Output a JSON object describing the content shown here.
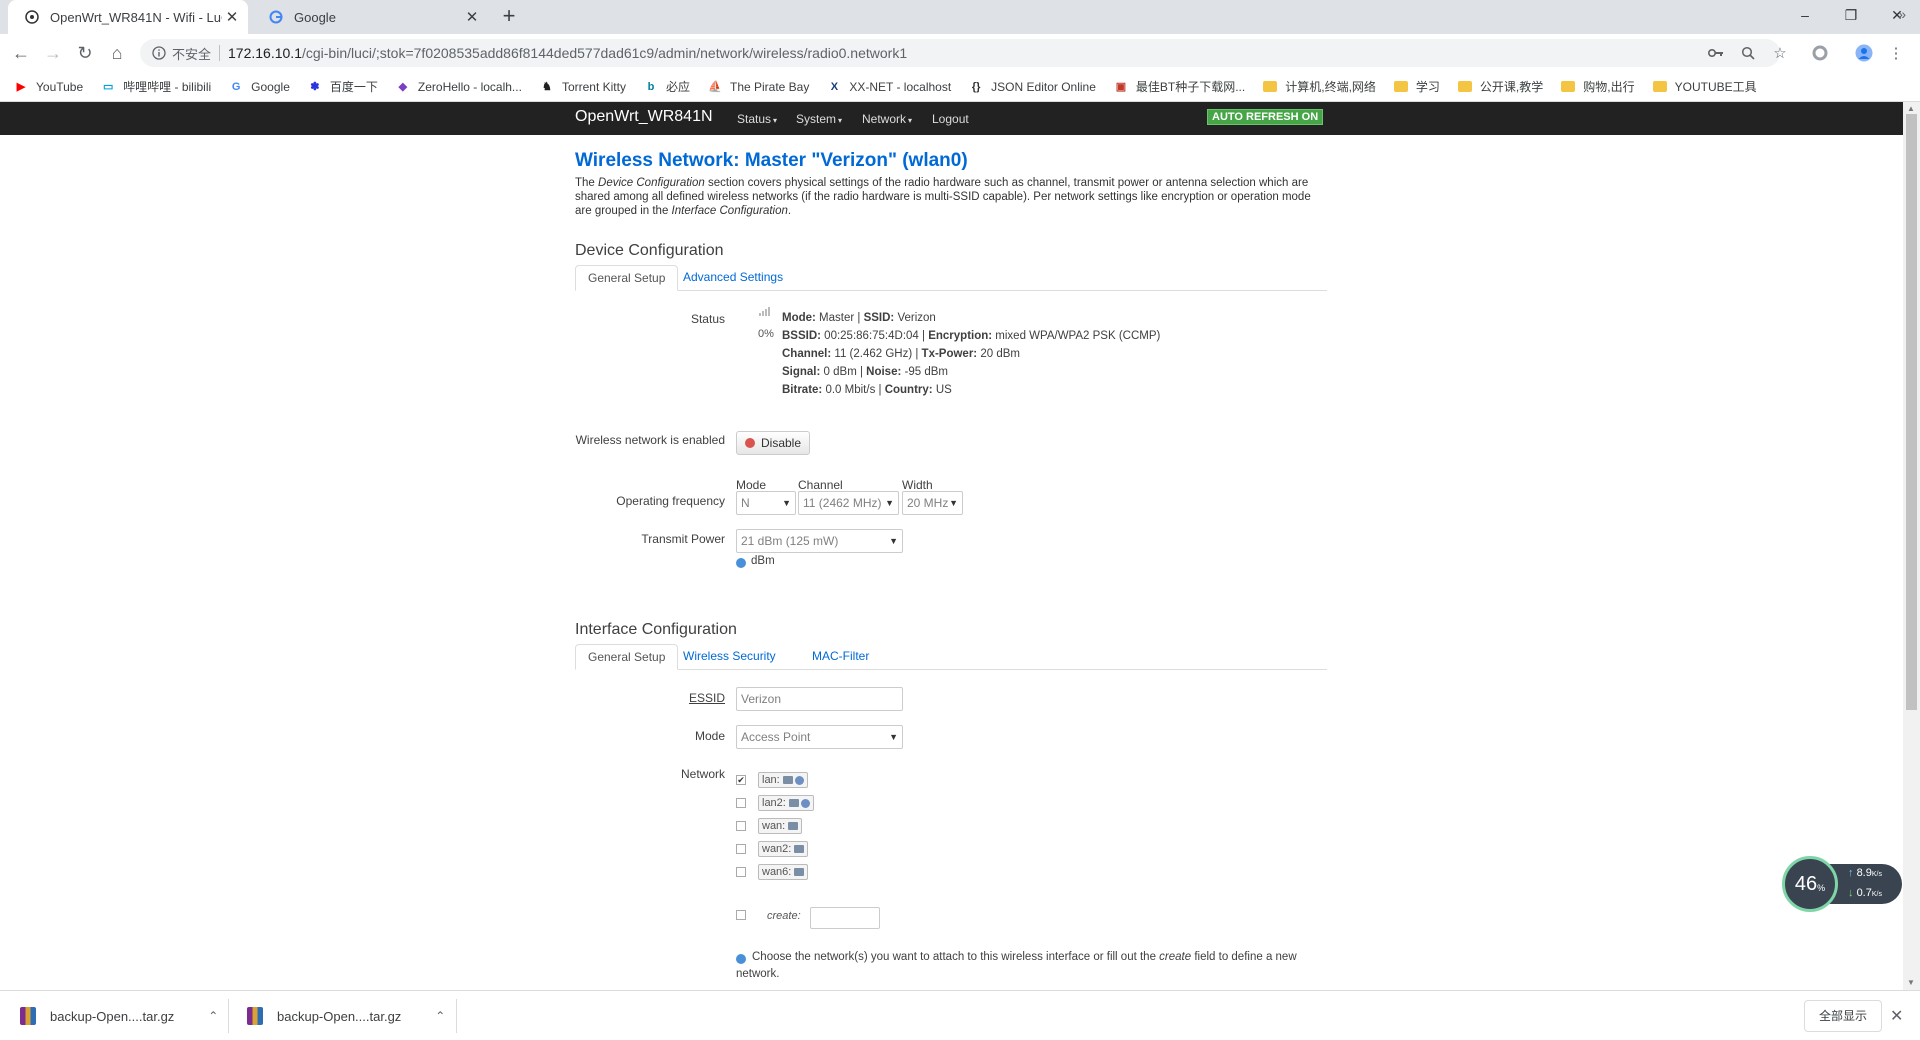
{
  "browser": {
    "tabs": [
      {
        "title": "OpenWrt_WR841N - Wifi - LuCI",
        "close": "✕"
      },
      {
        "title": "Google",
        "close": "✕"
      }
    ],
    "new_tab": "+",
    "window_controls": {
      "minimize": "–",
      "restore": "❐",
      "close": "✕"
    },
    "nav": {
      "back": "←",
      "forward": "→",
      "reload": "↻",
      "home": "⌂"
    },
    "address": {
      "security_label": "不安全",
      "host": "172.16.10.1",
      "path": "/cgi-bin/luci/;stok=7f0208535add86f8144ded577dad61c9/admin/network/wireless/radio0.network1"
    },
    "bookmarks": [
      {
        "label": "YouTube",
        "icon": "youtube-icon",
        "color": "#ff0000",
        "glyph": "▶"
      },
      {
        "label": "哔哩哔哩 - bilibili",
        "icon": "bilibili-icon",
        "color": "#00a1d6",
        "glyph": "▭"
      },
      {
        "label": "Google",
        "icon": "google-icon",
        "color": "#4285f4",
        "glyph": "G"
      },
      {
        "label": "百度一下",
        "icon": "baidu-icon",
        "color": "#2932e1",
        "glyph": "✽"
      },
      {
        "label": "ZeroHello - localh...",
        "icon": "zeronet-icon",
        "color": "#7b3fc4",
        "glyph": "◆"
      },
      {
        "label": "Torrent Kitty",
        "icon": "torrent-kitty-icon",
        "color": "#222222",
        "glyph": "♞"
      },
      {
        "label": "必应",
        "icon": "bing-icon",
        "color": "#00809d",
        "glyph": "b"
      },
      {
        "label": "The Pirate Bay",
        "icon": "pirate-bay-icon",
        "color": "#333333",
        "glyph": "⛵"
      },
      {
        "label": "XX-NET - localhost",
        "icon": "xx-net-icon",
        "color": "#1a3b7a",
        "glyph": "X"
      },
      {
        "label": "JSON Editor Online",
        "icon": "json-editor-icon",
        "color": "#333333",
        "glyph": "{}"
      },
      {
        "label": "最佳BT种子下载网...",
        "icon": "bt-site-icon",
        "color": "#c0392b",
        "glyph": "▣"
      },
      {
        "label": "计算机,终端,网络",
        "icon": "folder-icon",
        "color": "#f4c542",
        "glyph": ""
      },
      {
        "label": "学习",
        "icon": "folder-icon",
        "color": "#f4c542",
        "glyph": ""
      },
      {
        "label": "公开课,教学",
        "icon": "folder-icon",
        "color": "#f4c542",
        "glyph": ""
      },
      {
        "label": "购物,出行",
        "icon": "folder-icon",
        "color": "#f4c542",
        "glyph": ""
      },
      {
        "label": "YOUTUBE工具",
        "icon": "folder-icon",
        "color": "#f4c542",
        "glyph": ""
      }
    ],
    "bookmarks_more": "»"
  },
  "luci": {
    "brand": "OpenWrt_WR841N",
    "menu": [
      "Status",
      "System",
      "Network",
      "Logout"
    ],
    "auto_refresh": "AUTO REFRESH ON",
    "page_title": "Wireless Network: Master \"Verizon\" (wlan0)",
    "description": {
      "p1": "The ",
      "em1": "Device Configuration",
      "p2": " section covers physical settings of the radio hardware such as channel, transmit power or antenna selection which are shared among all defined wireless networks (if the radio hardware is multi-SSID capable). Per network settings like encryption or operation mode are grouped in the ",
      "em2": "Interface Configuration",
      "p3": "."
    },
    "device_config": {
      "title": "Device Configuration",
      "tabs": [
        "General Setup",
        "Advanced Settings"
      ],
      "status": {
        "label": "Status",
        "signal_percent": "0%",
        "lines": [
          [
            {
              "k": "Mode:",
              "v": " Master | "
            },
            {
              "k": "SSID:",
              "v": " Verizon"
            }
          ],
          [
            {
              "k": "BSSID:",
              "v": " 00:25:86:75:4D:04 | "
            },
            {
              "k": "Encryption:",
              "v": " mixed WPA/WPA2 PSK (CCMP)"
            }
          ],
          [
            {
              "k": "Channel:",
              "v": " 11 (2.462 GHz) | "
            },
            {
              "k": "Tx-Power:",
              "v": " 20 dBm"
            }
          ],
          [
            {
              "k": "Signal:",
              "v": " 0 dBm | "
            },
            {
              "k": "Noise:",
              "v": " -95 dBm"
            }
          ],
          [
            {
              "k": "Bitrate:",
              "v": " 0.0 Mbit/s | "
            },
            {
              "k": "Country:",
              "v": " US"
            }
          ]
        ]
      },
      "enabled_label": "Wireless network is enabled",
      "disable_button": "Disable",
      "op_freq": {
        "label": "Operating frequency",
        "mode_label": "Mode",
        "mode_value": "N",
        "channel_label": "Channel",
        "channel_value": "11 (2462 MHz)",
        "width_label": "Width",
        "width_value": "20 MHz"
      },
      "tx_power": {
        "label": "Transmit Power",
        "value": "21 dBm (125 mW)",
        "hint": "dBm"
      }
    },
    "iface_config": {
      "title": "Interface Configuration",
      "tabs": [
        "General Setup",
        "Wireless Security",
        "MAC-Filter"
      ],
      "essid_label": "ESSID",
      "essid_value": "Verizon",
      "mode_label": "Mode",
      "mode_value": "Access Point",
      "network_label": "Network",
      "networks": [
        {
          "name": "lan:",
          "checked": true
        },
        {
          "name": "lan2:",
          "checked": false
        },
        {
          "name": "wan:",
          "checked": false
        },
        {
          "name": "wan2:",
          "checked": false
        },
        {
          "name": "wan6:",
          "checked": false
        }
      ],
      "create_label": "create:",
      "network_hint_p1": "Choose the network(s) you want to attach to this wireless interface or fill out the ",
      "network_hint_em": "create",
      "network_hint_p2": " field to define a new network."
    }
  },
  "meter": {
    "percent": "46",
    "unit": "%",
    "up": "8.9",
    "down": "0.7",
    "rate_unit": "K/s"
  },
  "downloads": {
    "items": [
      "backup-Open....tar.gz",
      "backup-Open....tar.gz"
    ],
    "show_all": "全部显示",
    "close": "✕"
  }
}
